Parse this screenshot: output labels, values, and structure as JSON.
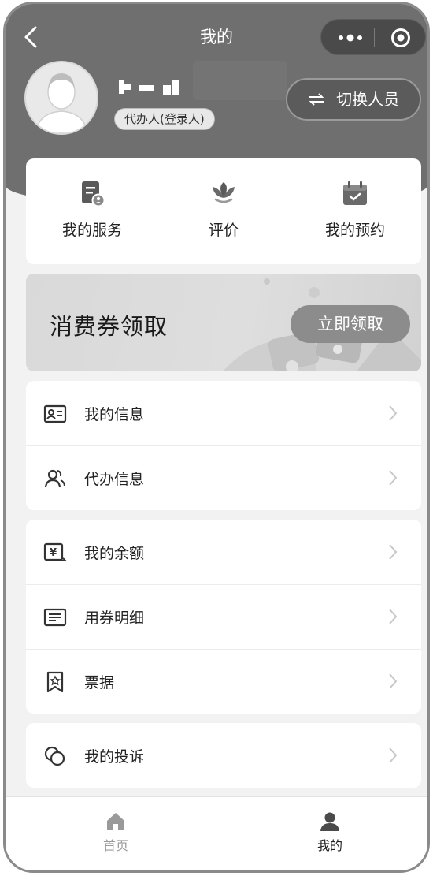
{
  "nav": {
    "title": "我的",
    "back_icon": "chevron-left-icon",
    "more_icon": "more-dots-icon",
    "close_icon": "target-circle-icon"
  },
  "profile": {
    "role": "代办人(登录人)",
    "switch_label": "切换人员",
    "switch_icon": "swap-arrows-icon"
  },
  "quick_actions": [
    {
      "label": "我的服务",
      "icon": "service-clipboard-icon"
    },
    {
      "label": "评价",
      "icon": "lotus-icon"
    },
    {
      "label": "我的预约",
      "icon": "calendar-check-icon"
    }
  ],
  "coupon": {
    "title": "消费券领取",
    "button_label": "立即领取"
  },
  "groups": [
    {
      "items": [
        {
          "label": "我的信息",
          "icon": "id-card-icon"
        },
        {
          "label": "代办信息",
          "icon": "users-icon"
        }
      ]
    },
    {
      "items": [
        {
          "label": "我的余额",
          "icon": "yuan-wallet-icon"
        },
        {
          "label": "用券明细",
          "icon": "ticket-list-icon"
        },
        {
          "label": "票据",
          "icon": "bookmark-star-icon"
        }
      ]
    },
    {
      "items": [
        {
          "label": "我的投诉",
          "icon": "chat-bubbles-icon"
        }
      ]
    }
  ],
  "tabbar": [
    {
      "label": "首页",
      "icon": "home-icon",
      "active": false
    },
    {
      "label": "我的",
      "icon": "person-icon",
      "active": true
    }
  ],
  "colors": {
    "header": "#6f6f6f",
    "background": "#f2f2f2",
    "card": "#ffffff",
    "text": "#222222",
    "inactive_tab": "#9a9a9a"
  }
}
